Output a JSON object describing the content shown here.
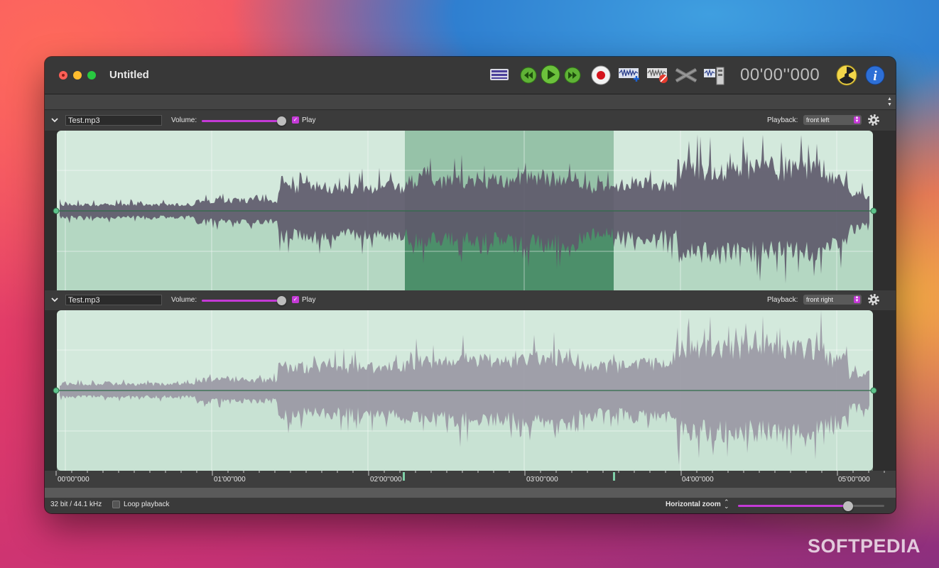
{
  "window": {
    "title": "Untitled"
  },
  "toolbar": {
    "time_display": "00'00''000",
    "buttons": [
      {
        "name": "track-list-button",
        "icon": "track-list-icon"
      },
      {
        "name": "rewind-button",
        "icon": "rewind-icon"
      },
      {
        "name": "play-button",
        "icon": "play-icon"
      },
      {
        "name": "fast-forward-button",
        "icon": "fast-forward-icon"
      },
      {
        "name": "record-button",
        "icon": "record-icon"
      },
      {
        "name": "add-track-button",
        "icon": "add-waveform-icon"
      },
      {
        "name": "delete-track-button",
        "icon": "delete-waveform-icon"
      },
      {
        "name": "crossfade-button",
        "icon": "crossfade-icon"
      },
      {
        "name": "export-button",
        "icon": "export-icon"
      },
      {
        "name": "burn-button",
        "icon": "radiation-icon"
      },
      {
        "name": "info-button",
        "icon": "info-icon"
      }
    ]
  },
  "tracks": [
    {
      "name": "Test.mp3",
      "volume_label": "Volume:",
      "volume_level": 0.95,
      "play_checked": true,
      "play_label": "Play",
      "playback_label": "Playback:",
      "playback_value": "front left",
      "has_selection": true
    },
    {
      "name": "Test.mp3",
      "volume_label": "Volume:",
      "volume_level": 0.95,
      "play_checked": true,
      "play_label": "Play",
      "playback_label": "Playback:",
      "playback_value": "front right",
      "has_selection": false
    }
  ],
  "ruler": {
    "labels": [
      "00'00''000",
      "01'00''000",
      "02'00''000",
      "03'00''000",
      "04'00''000",
      "05'00''000"
    ]
  },
  "status": {
    "format": "32 bit / 44.1 kHz",
    "loop_label": "Loop playback",
    "loop_checked": false,
    "zoom_label": "Horizontal zoom",
    "zoom_level": 0.75
  },
  "colors": {
    "accent": "#c43ad6",
    "wave_bg": "#d3e9dc",
    "selection": "#4c8f6a",
    "waveform": "#5e5a6b",
    "waveform_light": "#9a98a4"
  },
  "watermark": "SOFTPEDIA"
}
